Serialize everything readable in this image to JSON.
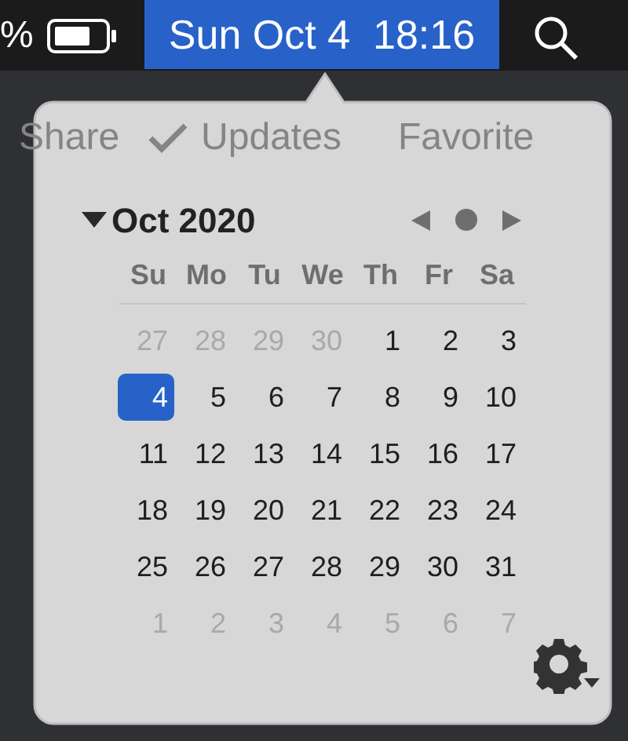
{
  "menu_bar": {
    "battery_percent": "%",
    "clock": "Sun Oct 4  18:16",
    "clock_selected": true
  },
  "background_toolbar": [
    {
      "label": "Share",
      "icon": false
    },
    {
      "label": "Updates",
      "icon": true
    },
    {
      "label": "Favorite",
      "icon": false
    }
  ],
  "calendar": {
    "month_title": "Oct 2020",
    "expanded": true,
    "weekdays": [
      "Su",
      "Mo",
      "Tu",
      "We",
      "Th",
      "Fr",
      "Sa"
    ],
    "days": [
      {
        "label": "27",
        "kind": "other",
        "selected": false
      },
      {
        "label": "28",
        "kind": "other",
        "selected": false
      },
      {
        "label": "29",
        "kind": "other",
        "selected": false
      },
      {
        "label": "30",
        "kind": "other",
        "selected": false
      },
      {
        "label": "1",
        "kind": "current",
        "selected": false
      },
      {
        "label": "2",
        "kind": "current",
        "selected": false
      },
      {
        "label": "3",
        "kind": "current",
        "selected": false
      },
      {
        "label": "4",
        "kind": "current",
        "selected": true
      },
      {
        "label": "5",
        "kind": "current",
        "selected": false
      },
      {
        "label": "6",
        "kind": "current",
        "selected": false
      },
      {
        "label": "7",
        "kind": "current",
        "selected": false
      },
      {
        "label": "8",
        "kind": "current",
        "selected": false
      },
      {
        "label": "9",
        "kind": "current",
        "selected": false
      },
      {
        "label": "10",
        "kind": "current",
        "selected": false
      },
      {
        "label": "11",
        "kind": "current",
        "selected": false
      },
      {
        "label": "12",
        "kind": "current",
        "selected": false
      },
      {
        "label": "13",
        "kind": "current",
        "selected": false
      },
      {
        "label": "14",
        "kind": "current",
        "selected": false
      },
      {
        "label": "15",
        "kind": "current",
        "selected": false
      },
      {
        "label": "16",
        "kind": "current",
        "selected": false
      },
      {
        "label": "17",
        "kind": "current",
        "selected": false
      },
      {
        "label": "18",
        "kind": "current",
        "selected": false
      },
      {
        "label": "19",
        "kind": "current",
        "selected": false
      },
      {
        "label": "20",
        "kind": "current",
        "selected": false
      },
      {
        "label": "21",
        "kind": "current",
        "selected": false
      },
      {
        "label": "22",
        "kind": "current",
        "selected": false
      },
      {
        "label": "23",
        "kind": "current",
        "selected": false
      },
      {
        "label": "24",
        "kind": "current",
        "selected": false
      },
      {
        "label": "25",
        "kind": "current",
        "selected": false
      },
      {
        "label": "26",
        "kind": "current",
        "selected": false
      },
      {
        "label": "27",
        "kind": "current",
        "selected": false
      },
      {
        "label": "28",
        "kind": "current",
        "selected": false
      },
      {
        "label": "29",
        "kind": "current",
        "selected": false
      },
      {
        "label": "30",
        "kind": "current",
        "selected": false
      },
      {
        "label": "31",
        "kind": "current",
        "selected": false
      },
      {
        "label": "1",
        "kind": "other",
        "selected": false
      },
      {
        "label": "2",
        "kind": "other",
        "selected": false
      },
      {
        "label": "3",
        "kind": "other",
        "selected": false
      },
      {
        "label": "4",
        "kind": "other",
        "selected": false
      },
      {
        "label": "5",
        "kind": "other",
        "selected": false
      },
      {
        "label": "6",
        "kind": "other",
        "selected": false
      },
      {
        "label": "7",
        "kind": "other",
        "selected": false
      }
    ]
  }
}
